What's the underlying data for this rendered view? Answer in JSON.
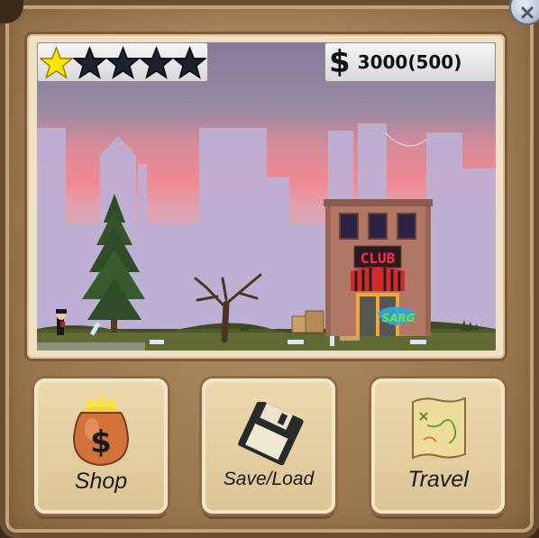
{
  "hud": {
    "stars_filled": 1,
    "stars_total": 5,
    "currency_symbol": "$",
    "money": "3000(500)"
  },
  "scene": {
    "club_sign": "CLUB",
    "graffiti": "SARG"
  },
  "buttons": {
    "shop": "Shop",
    "save_load": "Save/Load",
    "travel": "Travel"
  },
  "colors": {
    "star_filled": "#ffe400",
    "star_empty": "#1c2230",
    "sky_top": "#8a7b95",
    "sky_glow": "#e0838f",
    "club_sign_text": "#ff2a4f"
  }
}
